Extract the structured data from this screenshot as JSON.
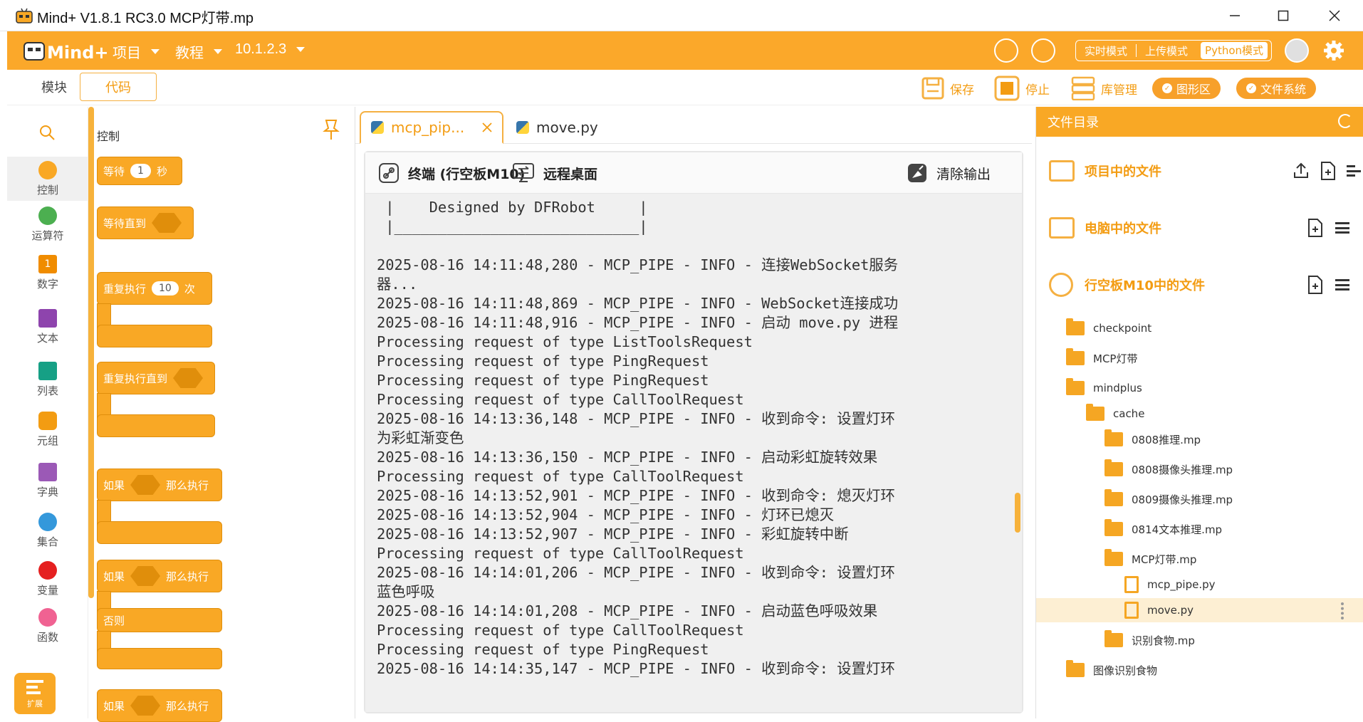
{
  "window": {
    "title": "Mind+ V1.8.1 RC3.0   MCP灯带.mp"
  },
  "menubar": {
    "logo_text": "Mind+",
    "menus": [
      "项目",
      "教程",
      "10.1.2.3"
    ],
    "modes": [
      "实时模式",
      "上传模式",
      "Python模式"
    ]
  },
  "toolbar2": {
    "tab_blocks": "模块",
    "tab_code": "代码",
    "save": "保存",
    "stop": "停止",
    "library": "库管理",
    "graphic_area": "图形区",
    "file_system": "文件系统"
  },
  "categories": [
    "控制",
    "运算符",
    "数字",
    "文本",
    "列表",
    "元组",
    "字典",
    "集合",
    "变量",
    "函数"
  ],
  "category_colors": [
    "#f9a825",
    "#4caf50",
    "#f08c00",
    "#8e44ad",
    "#16a085",
    "#f39c12",
    "#9b59b6",
    "#3498db",
    "#e52020",
    "#f06292"
  ],
  "extension_label": "扩展",
  "palette": {
    "title": "控制",
    "blocks": {
      "wait": "等待",
      "wait_num": "1",
      "wait_unit": "秒",
      "wait_until": "等待直到",
      "repeat": "重复执行",
      "repeat_num": "10",
      "repeat_unit": "次",
      "repeat_until": "重复执行直到",
      "if1": "如果",
      "then1": "那么执行",
      "if2": "如果",
      "then2": "那么执行",
      "else": "否则",
      "if3": "如果",
      "then3": "那么执行"
    }
  },
  "editor": {
    "tabs": [
      {
        "label": "mcp_pip...",
        "active": true
      },
      {
        "label": "move.py",
        "active": false
      }
    ],
    "terminal_label": "终端 (行空板M10)",
    "remote_desktop": "远程桌面",
    "clear_output": "清除输出",
    "lines": [
      " |    Designed by DFRobot     |",
      " |____________________________|",
      "",
      "2025-08-16 14:11:48,280 - MCP_PIPE - INFO - 连接WebSocket服务",
      "器...",
      "2025-08-16 14:11:48,869 - MCP_PIPE - INFO - WebSocket连接成功",
      "2025-08-16 14:11:48,916 - MCP_PIPE - INFO - 启动 move.py 进程",
      "Processing request of type ListToolsRequest",
      "Processing request of type PingRequest",
      "Processing request of type PingRequest",
      "Processing request of type CallToolRequest",
      "2025-08-16 14:13:36,148 - MCP_PIPE - INFO - 收到命令: 设置灯环",
      "为彩虹渐变色",
      "2025-08-16 14:13:36,150 - MCP_PIPE - INFO - 启动彩虹旋转效果",
      "Processing request of type CallToolRequest",
      "2025-08-16 14:13:52,901 - MCP_PIPE - INFO - 收到命令: 熄灭灯环",
      "2025-08-16 14:13:52,904 - MCP_PIPE - INFO - 灯环已熄灭",
      "2025-08-16 14:13:52,907 - MCP_PIPE - INFO - 彩虹旋转中断",
      "Processing request of type CallToolRequest",
      "2025-08-16 14:14:01,206 - MCP_PIPE - INFO - 收到命令: 设置灯环",
      "蓝色呼吸",
      "2025-08-16 14:14:01,208 - MCP_PIPE - INFO - 启动蓝色呼吸效果",
      "Processing request of type CallToolRequest",
      "Processing request of type PingRequest",
      "2025-08-16 14:14:35,147 - MCP_PIPE - INFO - 收到命令: 设置灯环"
    ]
  },
  "filedir": {
    "title": "文件目录",
    "sections": [
      "项目中的文件",
      "电脑中的文件",
      "行空板M10中的文件"
    ],
    "items": [
      {
        "label": "checkpoint",
        "kind": "folder"
      },
      {
        "label": "MCP灯带",
        "kind": "folder"
      },
      {
        "label": "mindplus",
        "kind": "folder"
      },
      {
        "label": "cache",
        "kind": "folder"
      },
      {
        "label": "0808推理.mp",
        "kind": "folder"
      },
      {
        "label": "0808摄像头推理.mp",
        "kind": "folder"
      },
      {
        "label": "0809摄像头推理.mp",
        "kind": "folder"
      },
      {
        "label": "0814文本推理.mp",
        "kind": "folder"
      },
      {
        "label": "MCP灯带.mp",
        "kind": "folder"
      },
      {
        "label": "mcp_pipe.py",
        "kind": "file"
      },
      {
        "label": "move.py",
        "kind": "file",
        "selected": true
      },
      {
        "label": "识别食物.mp",
        "kind": "folder"
      },
      {
        "label": "图像识别食物",
        "kind": "folder"
      }
    ]
  }
}
